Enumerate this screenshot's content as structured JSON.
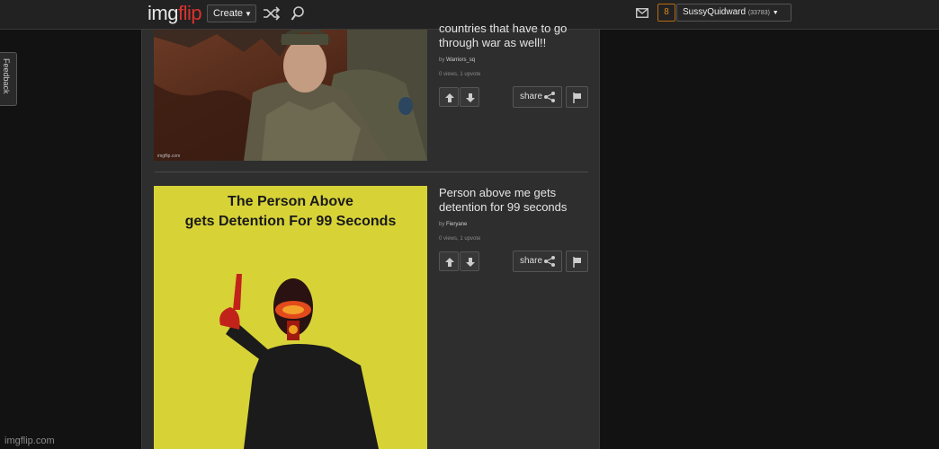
{
  "header": {
    "logo_part1": "img",
    "logo_part2": "flip",
    "create_label": "Create",
    "notification_count": "8",
    "username": "SussyQuidward",
    "user_points": "(33783)"
  },
  "feedback_label": "Feedback",
  "watermark": "imgflip.com",
  "posts": [
    {
      "title_visible_line1": "countries that have to go",
      "title_visible_line2": "through war as well!!",
      "by_prefix": "by",
      "author": "Warriors_sq",
      "stats": "0 views, 1 upvote",
      "share_label": "share",
      "image_watermark": "imgflip.com"
    },
    {
      "title": "Person above me gets detention for 99 seconds",
      "by_prefix": "by",
      "author": "Fieryane",
      "stats": "0 views, 1 upvote",
      "share_label": "share",
      "image_text_line1": "The Person Above",
      "image_text_line2": "gets Detention For 99 Seconds"
    }
  ],
  "colors": {
    "accent_red": "#d9322e",
    "notification_orange": "#e08a1e",
    "meme_yellow": "#d7d337"
  }
}
